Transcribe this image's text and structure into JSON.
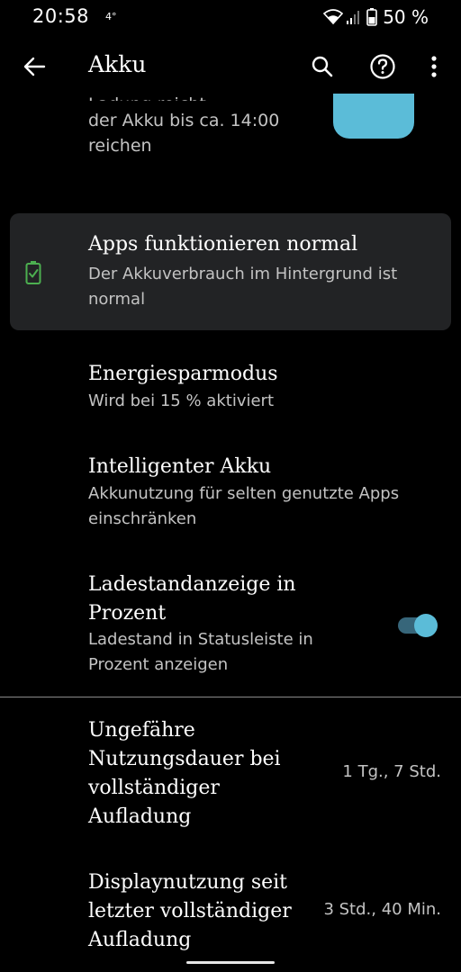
{
  "status_bar": {
    "time": "20:58",
    "temperature": "4°",
    "battery_text": "50 %"
  },
  "app_bar": {
    "title": "Akku",
    "icons": [
      "back-arrow-icon",
      "search-icon",
      "help-icon",
      "more-vert-icon"
    ]
  },
  "partial": {
    "cut_text": "Ladung reicht voraussichtlich",
    "line1": "der Akku bis ca. 14:00",
    "line2": "reichen"
  },
  "card": {
    "title": "Apps funktionieren normal",
    "subtitle": "Der Akkuverbrauch im Hintergrund ist normal",
    "icon": "battery-check-icon",
    "accent": "#4caf50"
  },
  "items": [
    {
      "title": "Energiesparmodus",
      "subtitle": "Wird bei 15 % aktiviert"
    },
    {
      "title": "Intelligenter Akku",
      "subtitle": "Akkunutzung für selten genutzte Apps einschränken"
    },
    {
      "title": "Ladestandanzeige in Prozent",
      "subtitle": "Ladestand in Statusleiste in Prozent anzeigen",
      "toggle_on": true
    }
  ],
  "usage": [
    {
      "title": "Ungefähre Nutzungsdauer bei vollständiger Aufladung",
      "value": "1 Tg., 7 Std."
    },
    {
      "title": "Displaynutzung seit letzter vollständiger Aufladung",
      "value": "3 Std., 40 Min."
    }
  ],
  "colors": {
    "background": "#000000",
    "card": "#222325",
    "accent": "#5bbcd8",
    "secondary_text": "#c3c3c3"
  }
}
